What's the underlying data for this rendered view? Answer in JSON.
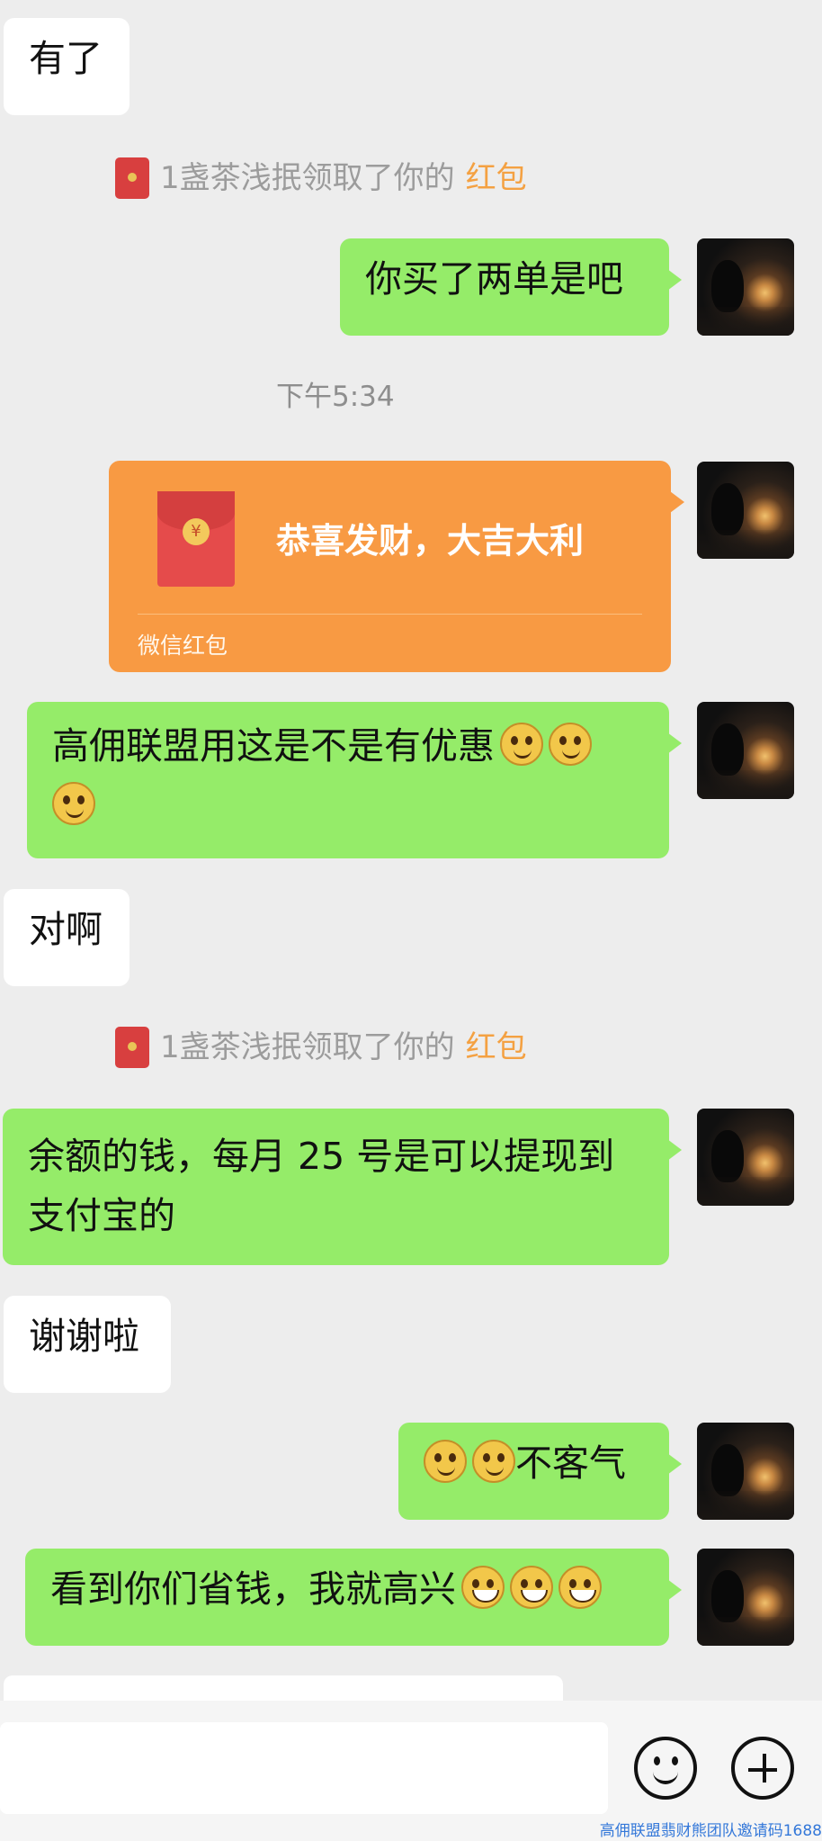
{
  "messages": [
    {
      "text": "有了"
    },
    {
      "system_prefix": "1盏茶浅抿领取了你的",
      "system_highlight": "红包"
    },
    {
      "text": "你买了两单是吧"
    },
    {
      "timestamp": "下午5:34"
    },
    {
      "red_packet_title": "恭喜发财，大吉大利",
      "red_packet_footer": "微信红包"
    },
    {
      "text": "高佣联盟用这是不是有优惠"
    },
    {
      "text": "对啊"
    },
    {
      "system_prefix": "1盏茶浅抿领取了你的",
      "system_highlight": "红包"
    },
    {
      "line1": "余额的钱，每月 25 号是可以提现到",
      "line2": "支付宝的"
    },
    {
      "text": "谢谢啦"
    },
    {
      "text": "不客气"
    },
    {
      "text": "看到你们省钱，我就高兴"
    }
  ],
  "icons": {
    "red_packet": "red-packet-icon",
    "emoji_smile": "smile-emoji-icon",
    "emoji_grin": "grin-emoji-icon",
    "emoji_button": "emoji-button-icon",
    "plus_button": "plus-button-icon"
  },
  "watermark": "高佣联盟翡财熊团队邀请码1688"
}
